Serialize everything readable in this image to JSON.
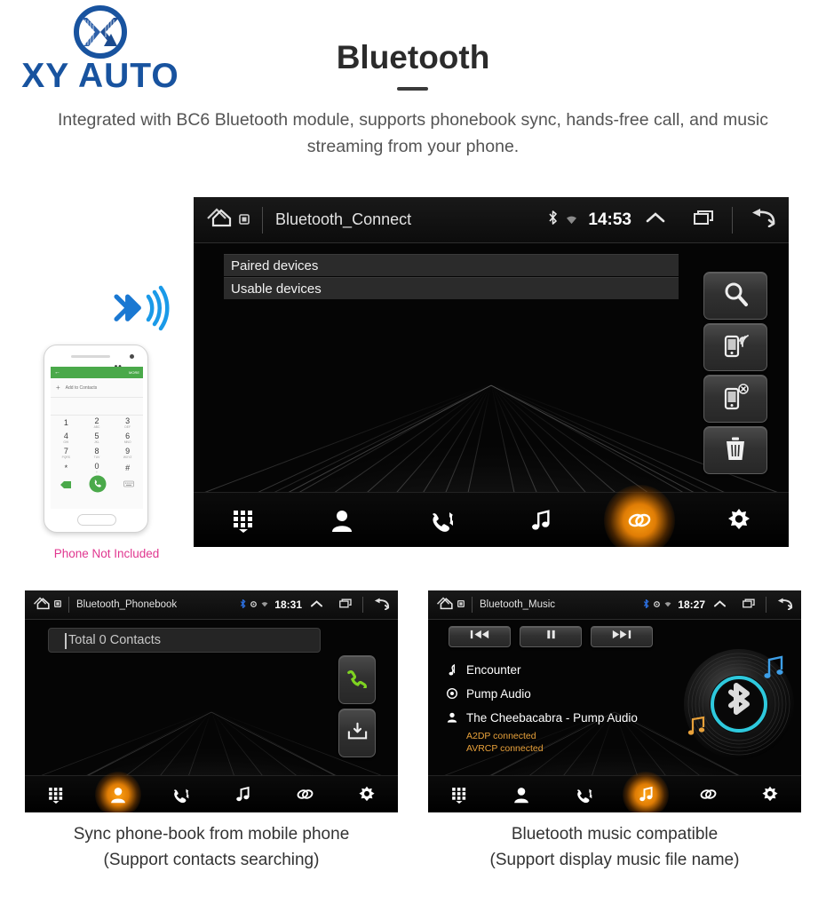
{
  "brand": {
    "name": "XY AUTO",
    "logo_icon": "xy-circle-logo",
    "color": "#18539f"
  },
  "header": {
    "title": "Bluetooth",
    "subtitle": "Integrated with BC6 Bluetooth module, supports phonebook sync, hands-free call, and music streaming from your phone."
  },
  "phone_mockup": {
    "caption": "Phone Not Included",
    "caption_color": "#e0368f",
    "bluetooth_icon": "bluetooth-signal-icon",
    "dialer": {
      "back_icon": "back-arrow-icon",
      "more_label": "MORE",
      "add_contact_label": "Add to Contacts",
      "add_icon": "plus-icon",
      "keys": [
        {
          "digit": "1",
          "sub": ""
        },
        {
          "digit": "2",
          "sub": "ABC"
        },
        {
          "digit": "3",
          "sub": "DEF"
        },
        {
          "digit": "4",
          "sub": "GHI"
        },
        {
          "digit": "5",
          "sub": "JKL"
        },
        {
          "digit": "6",
          "sub": "MNO"
        },
        {
          "digit": "7",
          "sub": "PQRS"
        },
        {
          "digit": "8",
          "sub": "TUV"
        },
        {
          "digit": "9",
          "sub": "WXYZ"
        },
        {
          "digit": "*",
          "sub": ""
        },
        {
          "digit": "0",
          "sub": "+"
        },
        {
          "digit": "#",
          "sub": ""
        }
      ],
      "call_icon": "call-button-icon",
      "backspace_icon": "backspace-icon",
      "keyboard_icon": "keyboard-icon"
    }
  },
  "main_screen": {
    "statusbar": {
      "home_icon": "home-icon",
      "app_icon": "app-badge-icon",
      "title": "Bluetooth_Connect",
      "bluetooth_icon": "bluetooth-icon",
      "wifi_icon": "wifi-icon",
      "time": "14:53",
      "chevron_icon": "chevron-up-icon",
      "recents_icon": "recents-icon",
      "back_icon": "back-icon"
    },
    "lists": [
      {
        "label": "Paired devices"
      },
      {
        "label": "Usable devices"
      }
    ],
    "side_buttons": [
      {
        "name": "search-button",
        "icon": "search-icon"
      },
      {
        "name": "connect-device-button",
        "icon": "phone-connect-icon"
      },
      {
        "name": "disconnect-device-button",
        "icon": "phone-disconnect-icon"
      },
      {
        "name": "delete-device-button",
        "icon": "trash-icon"
      }
    ],
    "nav": [
      {
        "name": "dialpad",
        "icon": "dialpad-icon",
        "active": false
      },
      {
        "name": "contacts",
        "icon": "contacts-icon",
        "active": false
      },
      {
        "name": "call-history",
        "icon": "call-history-icon",
        "active": false
      },
      {
        "name": "music",
        "icon": "music-note-icon",
        "active": false
      },
      {
        "name": "link",
        "icon": "link-icon",
        "active": true
      },
      {
        "name": "settings",
        "icon": "gear-icon",
        "active": false
      }
    ],
    "active_color": "#ffa416"
  },
  "phonebook_screen": {
    "statusbar": {
      "home_icon": "home-icon",
      "app_icon": "app-badge-icon",
      "title": "Bluetooth_Phonebook",
      "bluetooth_icon": "bluetooth-icon",
      "gps_icon": "gps-icon",
      "wifi_icon": "wifi-icon",
      "time": "18:31",
      "chevron_icon": "chevron-up-icon",
      "recents_icon": "recents-icon",
      "back_icon": "back-icon"
    },
    "search_field": {
      "value": "",
      "placeholder": "Total 0 Contacts"
    },
    "side_buttons": [
      {
        "name": "call-button",
        "icon": "green-call-icon"
      },
      {
        "name": "download-contacts-button",
        "icon": "download-icon"
      }
    ],
    "nav": [
      {
        "name": "dialpad",
        "icon": "dialpad-icon",
        "active": false
      },
      {
        "name": "contacts",
        "icon": "contacts-icon",
        "active": true
      },
      {
        "name": "call-history",
        "icon": "call-history-icon",
        "active": false
      },
      {
        "name": "music",
        "icon": "music-note-icon",
        "active": false
      },
      {
        "name": "link",
        "icon": "link-icon",
        "active": false
      },
      {
        "name": "settings",
        "icon": "gear-icon",
        "active": false
      }
    ],
    "caption_line1": "Sync phone-book from mobile phone",
    "caption_line2": "(Support contacts searching)"
  },
  "music_screen": {
    "statusbar": {
      "home_icon": "home-icon",
      "app_icon": "app-badge-icon",
      "title": "Bluetooth_Music",
      "bluetooth_icon": "bluetooth-icon",
      "gps_icon": "gps-icon",
      "wifi_icon": "wifi-icon",
      "time": "18:27",
      "chevron_icon": "chevron-up-icon",
      "recents_icon": "recents-icon",
      "back_icon": "back-icon"
    },
    "transport": [
      {
        "name": "previous-track-button",
        "icon": "skip-previous-icon"
      },
      {
        "name": "pause-button",
        "icon": "pause-icon"
      },
      {
        "name": "next-track-button",
        "icon": "skip-next-icon"
      }
    ],
    "track": {
      "title": "Encounter",
      "title_icon": "note-icon",
      "album": "Pump Audio",
      "album_icon": "disc-icon",
      "artist": "The Cheebacabra - Pump Audio",
      "artist_icon": "person-icon"
    },
    "profiles": [
      {
        "label": "A2DP connected"
      },
      {
        "label": "AVRCP connected"
      }
    ],
    "profile_color": "#e8a13a",
    "disc_icon": "vinyl-bluetooth-disc",
    "nav": [
      {
        "name": "dialpad",
        "icon": "dialpad-icon",
        "active": false
      },
      {
        "name": "contacts",
        "icon": "contacts-icon",
        "active": false
      },
      {
        "name": "call-history",
        "icon": "call-history-icon",
        "active": false
      },
      {
        "name": "music",
        "icon": "music-note-icon",
        "active": true
      },
      {
        "name": "link",
        "icon": "link-icon",
        "active": false
      },
      {
        "name": "settings",
        "icon": "gear-icon",
        "active": false
      }
    ],
    "caption_line1": "Bluetooth music compatible",
    "caption_line2": "(Support display music file name)"
  }
}
